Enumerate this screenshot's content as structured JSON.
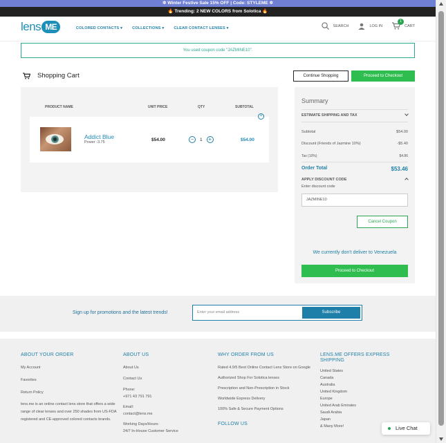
{
  "promo": {
    "line1": "✲ Winter Festive Sale 15% OFF | Code: STYLEME ✲",
    "line2_fire": "🔥",
    "line2_text": " Trending: 2 NEW COLORS from Solotica ",
    "line2_end": "🔥"
  },
  "header": {
    "logo_text": "lens",
    "logo_badge": "ME",
    "nav": [
      "COLORED CONTACTS ▾",
      "COLLECTIONS ▾",
      "CLEAR CONTACT LENSES ▾"
    ],
    "search_label": "SEARCH",
    "login_label": "LOG IN",
    "cart_label": "CART",
    "cart_count": "1"
  },
  "notice": "You used coupon code \"JAZMINE10\".",
  "cart": {
    "title": "Shopping Cart",
    "continue_label": "Continue Shopping",
    "checkout_label": "Proceed to Checkout",
    "columns": {
      "product": "PRODUCT NAME",
      "unit_price": "UNIT PRICE",
      "qty": "QTY",
      "subtotal": "SUBTOTAL"
    },
    "item": {
      "name": "Addict Blue",
      "power": "Power -3.75",
      "unit_price": "$54.00",
      "qty": "1",
      "minus": "−",
      "plus": "+",
      "subtotal": "$54.00",
      "remove": "×"
    }
  },
  "summary": {
    "title": "Summary",
    "shipping_tax": "ESTIMATE SHIPPING AND TAX",
    "subtotal_label": "Subtotal",
    "subtotal_value": "$54.00",
    "discount_label": "Discount (Friends of Jazmine 10%)",
    "discount_value": "-$5.40",
    "tax_label": "Tax (10%)",
    "tax_value": "$4.86",
    "order_total_label": "Order Total",
    "order_total_value": "$53.46",
    "apply_discount": "APPLY DISCOUNT CODE",
    "discount_code_label": "Enter discount code",
    "discount_code_value": "JAZMINE10",
    "cancel_coupon": "Cancel Coupon",
    "no_delivery": "We currently don't deliver to Venezuela",
    "checkout_label": "Proceed to Checkout"
  },
  "signup": {
    "text": "Sign up for promotions and the latest trends!",
    "placeholder": "Enter your email address",
    "subscribe": "Subscribe"
  },
  "footer": {
    "about_order": {
      "heading": "ABOUT YOUR ORDER",
      "items": [
        "My Account",
        "Favorites",
        "Return Policy"
      ],
      "desc": "lens.me is an online contact lens store that offers a wide range of clear lenses and over 250 shades from US-FDA registered and CE-approved colored contacts brands."
    },
    "about_us": {
      "heading": "ABOUT US",
      "items": [
        "About Us",
        "Contact Us"
      ],
      "phone_label": "Phone:",
      "phone": "+971 43 791 791",
      "email_label": "Email:",
      "email": "contact@lens.me",
      "hours_label": "Working Days/Hours:",
      "hours": "24/7 In-House Customer Service"
    },
    "why_order": {
      "heading": "WHY ORDER FROM US",
      "items": [
        "Rated 4.9/5 Best Online Contact Lens Store on Google",
        "Authorized Shop For Solotica lenses",
        "Prescription and Non-Prescription in Stock",
        "Worldwide Express Delivery",
        "100% Safe & Secure Payment Options"
      ],
      "follow": "FOLLOW US"
    },
    "express": {
      "heading": "LENS.ME OFFERS EXPRESS SHIPPING",
      "items": [
        "United States",
        "Canada",
        "Australia",
        "United Kingdom",
        "Europe",
        "United Arab Emirates",
        "Saudi Arabia",
        "Japan",
        "& Many More!"
      ]
    }
  },
  "live_chat": "Live Chat"
}
